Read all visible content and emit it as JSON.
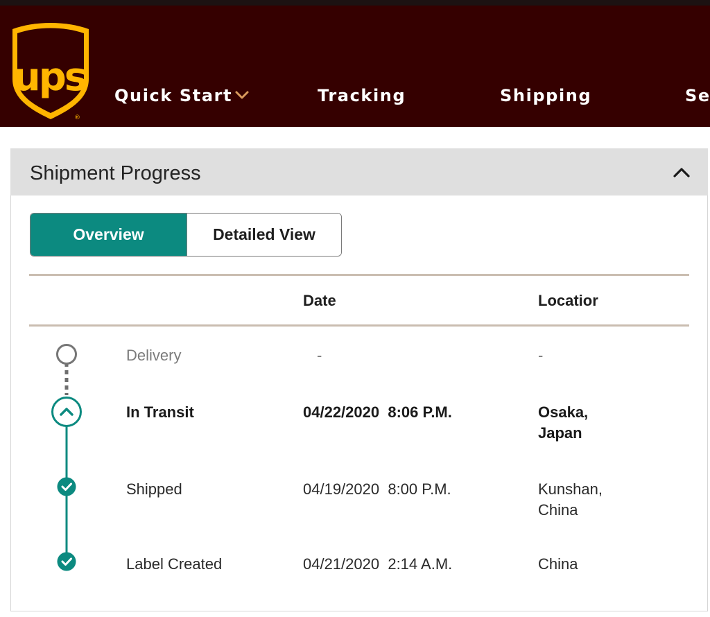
{
  "header": {
    "logo_text": "ups",
    "nav": [
      {
        "label": "Quick Start",
        "has_dropdown": true
      },
      {
        "label": "Tracking"
      },
      {
        "label": "Shipping"
      },
      {
        "label": "Se"
      }
    ]
  },
  "panel": {
    "title": "Shipment Progress",
    "tabs": [
      {
        "label": "Overview",
        "selected": true
      },
      {
        "label": "Detailed View",
        "selected": false
      }
    ],
    "columns": [
      "Date",
      "Locatior"
    ],
    "events": [
      {
        "status": "Delivery",
        "date": "-",
        "location": "-",
        "state": "pending"
      },
      {
        "status": "In Transit",
        "date": "04/22/2020  8:06 P.M.",
        "location": "Osaka, Japan",
        "state": "current"
      },
      {
        "status": "Shipped",
        "date": "04/19/2020  8:00 P.M.",
        "location": "Kunshan, China",
        "state": "done"
      },
      {
        "status": "Label Created",
        "date": "04/21/2020  2:14 A.M.",
        "location": "China",
        "state": "done"
      }
    ]
  },
  "colors": {
    "header_bg": "#350000",
    "logo_gold": "#ffb500",
    "accent_teal": "#0c8a80",
    "panel_head_bg": "#dfdfdf",
    "rule": "#cabdb0"
  }
}
